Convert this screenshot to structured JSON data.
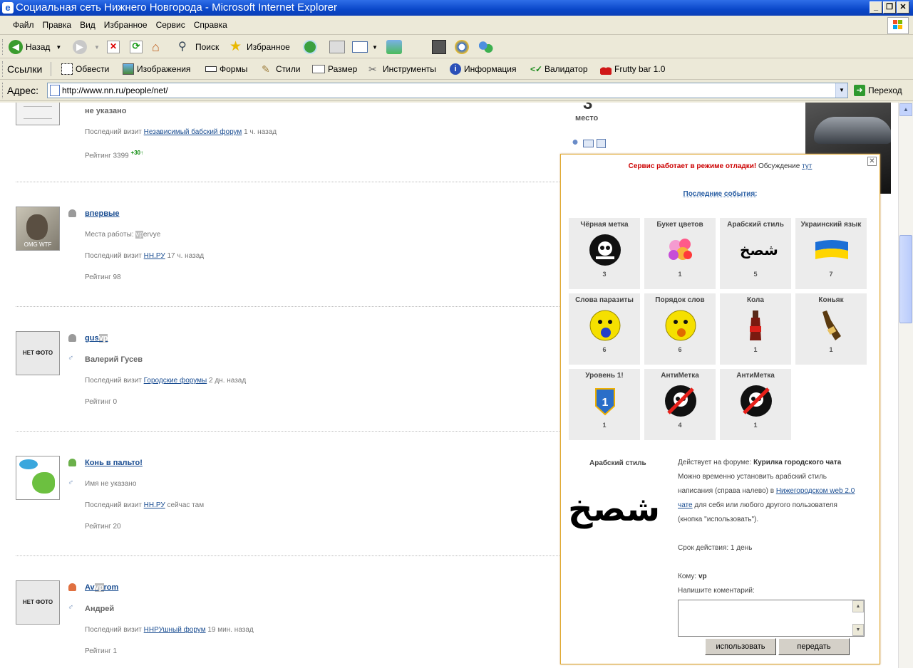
{
  "window": {
    "title": "Социальная сеть Нижнего Новгорода - Microsoft Internet Explorer",
    "min_glyph": "_",
    "max_glyph": "❐",
    "close_glyph": "✕"
  },
  "menu": [
    "Файл",
    "Правка",
    "Вид",
    "Избранное",
    "Сервис",
    "Справка"
  ],
  "toolbar": {
    "back": "Назад",
    "search": "Поиск",
    "favorites": "Избранное"
  },
  "linksbar": {
    "label": "Ссылки",
    "items": [
      "Обвести",
      "Изображения",
      "Формы",
      "Стили",
      "Размер",
      "Инструменты",
      "Информация",
      "Валидатор",
      "Frutty bar 1.0"
    ]
  },
  "address": {
    "label": "Адрес:",
    "url": "http://www.nn.ru/people/net/",
    "go": "Переход"
  },
  "people": [
    {
      "name": "",
      "line1": "не указано",
      "visit_prefix": "Последний визит",
      "visit_link": "Независимый бабский форум",
      "visit_suffix": "1 ч. назад",
      "rating": "Рейтинг 3399",
      "delta": "+30"
    },
    {
      "name": "впервые",
      "line1_prefix": "Места работы:",
      "line1_hl": "vp",
      "line1_rest": "ervye",
      "visit_prefix": "Последний визит",
      "visit_link": "НН.РУ",
      "visit_suffix": "17 ч. назад",
      "rating": "Рейтинг 98",
      "avatar_caption": "OMG WTF"
    },
    {
      "name_a": "gus",
      "name_hl": "vp",
      "line1": "Валерий Гусев",
      "visit_prefix": "Последний визит",
      "visit_link": "Городские форумы",
      "visit_suffix": "2 дн. назад",
      "rating": "Рейтинг 0",
      "nofoto": "НЕТ ФОТО"
    },
    {
      "name": "Конь в пальто!",
      "line1": "Имя не указано",
      "visit_prefix": "Последний визит",
      "visit_link": "НН.РУ",
      "visit_suffix": "сейчас там",
      "rating": "Рейтинг 20"
    },
    {
      "name_a": "Av",
      "name_hl": "vp",
      "name_b": "rom",
      "line1": "Андрей",
      "visit_prefix": "Последний визит",
      "visit_link": "ННРУшный форум",
      "visit_suffix": "19 мин. назад",
      "rating": "Рейтинг 1",
      "nofoto": "НЕТ ФОТО"
    }
  ],
  "right": {
    "place_number": "3",
    "place_label": "место"
  },
  "popup": {
    "notice_red": "Сервис работает в режиме отладки!",
    "notice_text": "Обсуждение",
    "notice_link": "тут",
    "recent_title": "Последние события:",
    "gifts": [
      {
        "title": "Чёрная метка",
        "count": "3",
        "icon": "skull-icon"
      },
      {
        "title": "Букет цветов",
        "count": "1",
        "icon": "flowers-icon"
      },
      {
        "title": "Арабский стиль",
        "count": "5",
        "icon": "arabic-icon",
        "glyph": "شصخ"
      },
      {
        "title": "Украинский язык",
        "count": "7",
        "icon": "ukraine-flag-icon"
      },
      {
        "title": "Слова паразиты",
        "count": "6",
        "icon": "smiley-ball-icon"
      },
      {
        "title": "Порядок слов",
        "count": "6",
        "icon": "smiley-mouth-icon"
      },
      {
        "title": "Кола",
        "count": "1",
        "icon": "cola-bottle-icon"
      },
      {
        "title": "Коньяк",
        "count": "1",
        "icon": "cognac-bottle-icon"
      },
      {
        "title": "Уровень 1!",
        "count": "1",
        "icon": "level-badge-icon",
        "badge": "1"
      },
      {
        "title": "АнтиМетка",
        "count": "4",
        "icon": "anti-skull-icon"
      },
      {
        "title": "АнтиМетка",
        "count": "1",
        "icon": "anti-skull-icon"
      }
    ],
    "detail": {
      "title": "Арабский стиль",
      "big_glyph": "شصخ",
      "forum_prefix": "Действует на форуме:",
      "forum_name": "Курилка городского чата",
      "desc_1": "Можно временно установить арабский стиль",
      "desc_2": "написания (справа налево) в",
      "desc_link": "Нижегородском web 2.0",
      "desc_link2": "чате",
      "desc_3": "для себя или любого другого пользователя",
      "desc_4": "(кнопка \"использовать\").",
      "expiry": "Срок действия: 1 день",
      "to_label": "Кому:",
      "to_value": "vp",
      "comment_label": "Напишите коментарий:",
      "use_button": "использовать",
      "send_button": "передать"
    }
  }
}
